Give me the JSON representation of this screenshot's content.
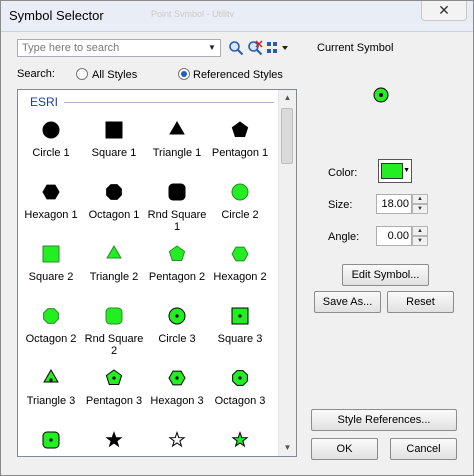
{
  "window": {
    "title": "Symbol Selector",
    "ghost_title": "Point Symbol - Utility",
    "close_glyph": "✕"
  },
  "search": {
    "placeholder": "Type here to search",
    "value": ""
  },
  "search_scope": {
    "label": "Search:",
    "all_styles": "All Styles",
    "referenced_styles": "Referenced Styles",
    "selected": "referenced_styles"
  },
  "gallery": {
    "group": "ESRI",
    "items": [
      {
        "label": "Circle 1"
      },
      {
        "label": "Square 1"
      },
      {
        "label": "Triangle 1"
      },
      {
        "label": "Pentagon 1"
      },
      {
        "label": "Hexagon 1"
      },
      {
        "label": "Octagon 1"
      },
      {
        "label": "Rnd Square 1"
      },
      {
        "label": "Circle 2"
      },
      {
        "label": "Square 2"
      },
      {
        "label": "Triangle 2"
      },
      {
        "label": "Pentagon 2"
      },
      {
        "label": "Hexagon 2"
      },
      {
        "label": "Octagon 2"
      },
      {
        "label": "Rnd Square 2"
      },
      {
        "label": "Circle 3"
      },
      {
        "label": "Square 3"
      },
      {
        "label": "Triangle 3"
      },
      {
        "label": "Pentagon 3"
      },
      {
        "label": "Hexagon 3"
      },
      {
        "label": "Octagon 3"
      },
      {
        "label": ""
      },
      {
        "label": ""
      },
      {
        "label": ""
      },
      {
        "label": ""
      }
    ]
  },
  "current_symbol": {
    "title": "Current Symbol",
    "color_label": "Color:",
    "color": "#22ee22",
    "size_label": "Size:",
    "size": "18.00",
    "angle_label": "Angle:",
    "angle": "0.00",
    "edit_symbol": "Edit Symbol...",
    "save_as": "Save As...",
    "reset": "Reset"
  },
  "footer": {
    "style_references": "Style References...",
    "ok": "OK",
    "cancel": "Cancel"
  },
  "colors": {
    "green": "#22ee22",
    "black": "#000000",
    "accent": "#1f5fbf"
  }
}
